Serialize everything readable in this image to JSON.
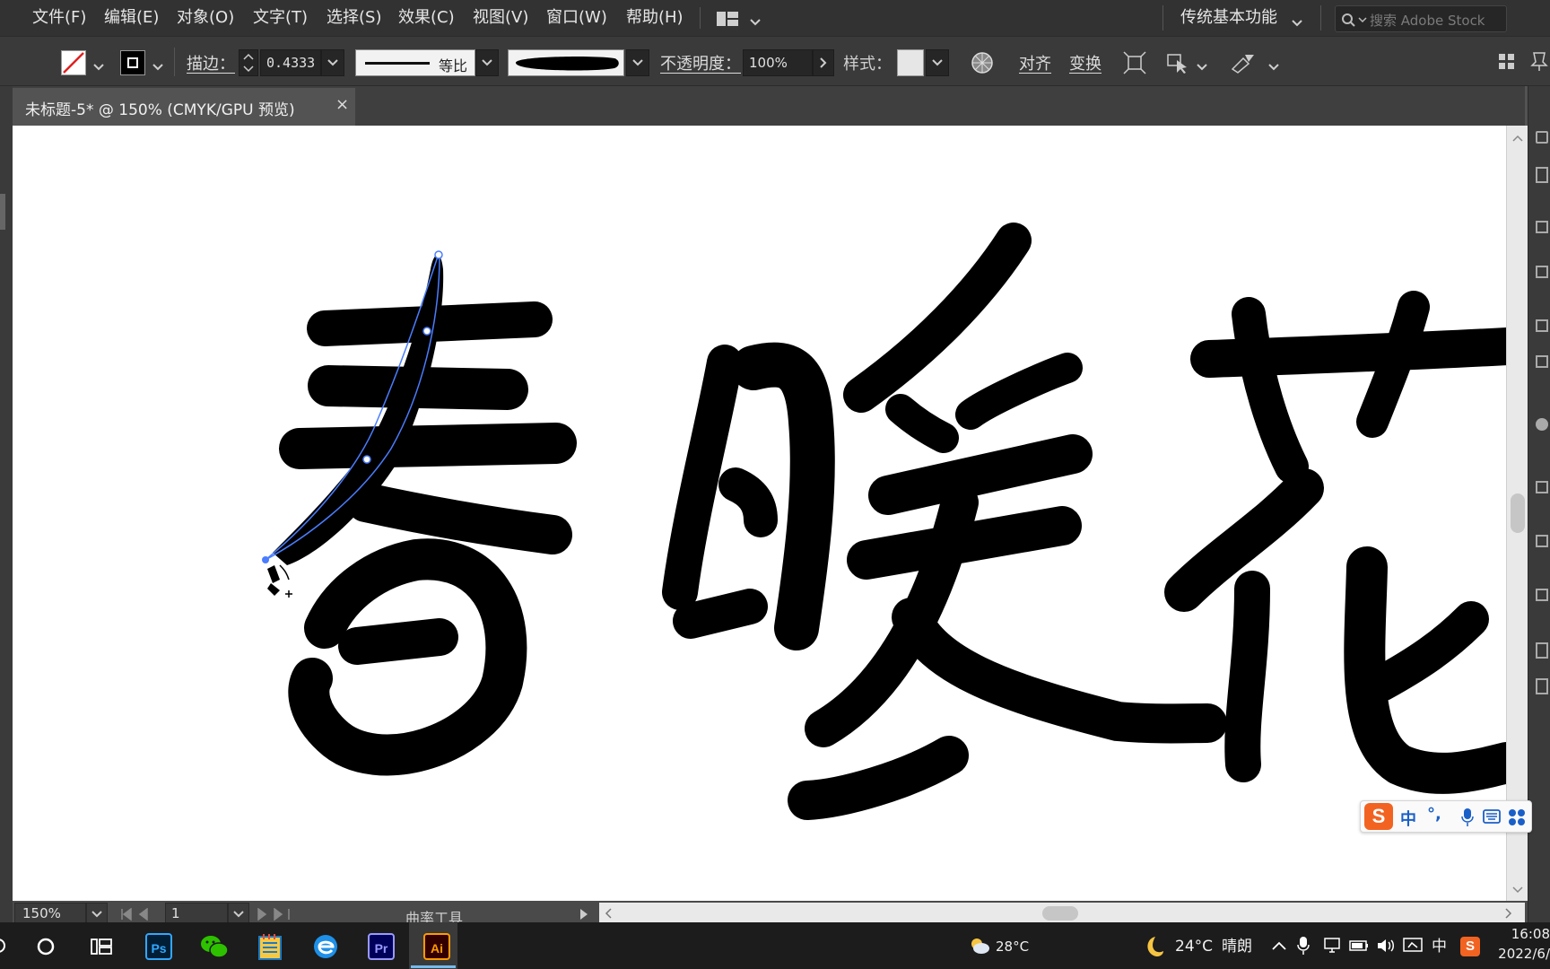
{
  "menubar": {
    "items": [
      "文件(F)",
      "编辑(E)",
      "对象(O)",
      "文字(T)",
      "选择(S)",
      "效果(C)",
      "视图(V)",
      "窗口(W)",
      "帮助(H)"
    ],
    "workspace": "传统基本功能",
    "search_placeholder": "搜索 Adobe Stock"
  },
  "controlbar": {
    "stroke_label": "描边：",
    "stroke_value": "0.4333",
    "profile_label": "等比",
    "opacity_label": "不透明度：",
    "opacity_value": "100%",
    "style_label": "样式：",
    "align_label": "对齐",
    "transform_label": "变换"
  },
  "document": {
    "tab_title": "未标题-5* @ 150% (CMYK/GPU 预览)",
    "close_glyph": "×"
  },
  "statusbar": {
    "zoom": "150%",
    "artboard": "1",
    "tool_name": "曲率工具"
  },
  "ime": {
    "mode": "中",
    "punct": "°,"
  },
  "taskbar": {
    "apps": [
      "Ps",
      "Pr",
      "Ai"
    ],
    "weather_temp": "28°C",
    "night_temp": "24°C",
    "night_condition": "晴朗",
    "lang": "中",
    "time": "16:08",
    "date": "2022/6/"
  },
  "colors": {
    "accent_ai": "#ff9a00",
    "ai_bg": "#330000",
    "ps_accent": "#31a8ff",
    "ps_bg": "#001e36",
    "pr_accent": "#9999ff",
    "pr_bg": "#00005b",
    "ime_orange": "#f26322",
    "path_blue": "#4a7dff"
  }
}
